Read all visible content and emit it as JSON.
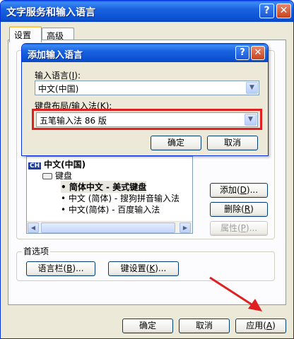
{
  "window": {
    "title": "文字服务和输入语言",
    "help_label": "?",
    "close_label": "✕"
  },
  "tabs": [
    {
      "label": "设置",
      "active": true
    },
    {
      "label": "高级",
      "active": false
    }
  ],
  "installed_services": {
    "language": "中文(中国)",
    "lang_badge": "CH",
    "category": "键盘",
    "items": [
      "简体中文 - 美式键盘",
      "中文 (简体) - 搜狗拼音输入法",
      "中文(简体) - 百度输入法"
    ],
    "add_button": {
      "label": "添加",
      "key": "D",
      "suffix": "..."
    },
    "remove_button": {
      "label": "删除",
      "key": "R",
      "suffix": ""
    },
    "properties_button": {
      "label": "属性",
      "key": "P",
      "suffix": "..."
    }
  },
  "preferences": {
    "group_label": "首选项",
    "language_bar_button": {
      "label": "语言栏",
      "key": "B",
      "suffix": "..."
    },
    "key_settings_button": {
      "label": "键设置",
      "key": "K",
      "suffix": "..."
    }
  },
  "footer": {
    "ok": "确定",
    "cancel": "取消",
    "apply": {
      "label": "应用",
      "key": "A"
    }
  },
  "add_dialog": {
    "title": "添加输入语言",
    "help_label": "?",
    "close_label": "✕",
    "input_language_label": {
      "label": "输入语言",
      "key": "I",
      "suffix": ":"
    },
    "input_language_value": "中文(中国)",
    "keyboard_label": {
      "label": "键盘布局/输入法",
      "key": "K",
      "suffix": ":"
    },
    "keyboard_value": "五笔输入法 86 版",
    "ok": "确定",
    "cancel": "取消"
  },
  "annotation": {
    "highlight_color": "#e02020",
    "arrow_color": "#e02020"
  }
}
